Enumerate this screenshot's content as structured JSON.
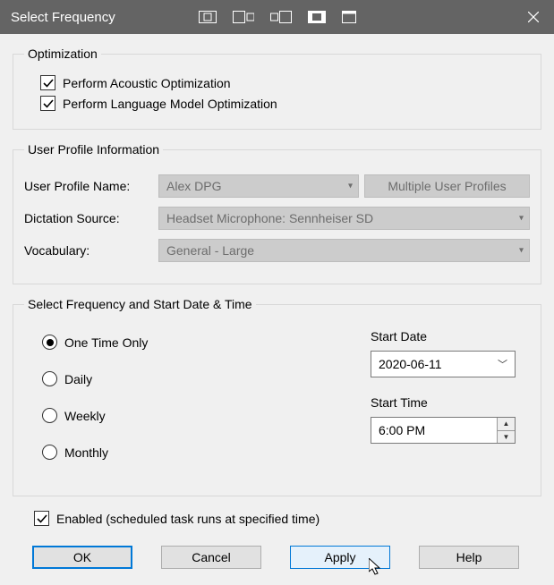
{
  "title": "Select Frequency",
  "optimization": {
    "legend": "Optimization",
    "acoustic_label": "Perform Acoustic Optimization",
    "language_label": "Perform Language Model Optimization"
  },
  "profile": {
    "legend": "User Profile Information",
    "name_label": "User Profile Name:",
    "name_value": "Alex DPG",
    "multi_button": "Multiple User Profiles",
    "source_label": "Dictation Source:",
    "source_value": "Headset Microphone: Sennheiser SD",
    "vocab_label": "Vocabulary:",
    "vocab_value": "General - Large"
  },
  "frequency": {
    "legend": "Select Frequency and Start Date & Time",
    "one_time": "One Time Only",
    "daily": "Daily",
    "weekly": "Weekly",
    "monthly": "Monthly",
    "start_date_label": "Start Date",
    "start_date_value": "2020-06-11",
    "start_time_label": "Start Time",
    "start_time_value": "6:00 PM"
  },
  "enabled_label": "Enabled (scheduled task runs at specified time)",
  "buttons": {
    "ok": "OK",
    "cancel": "Cancel",
    "apply": "Apply",
    "help": "Help"
  }
}
